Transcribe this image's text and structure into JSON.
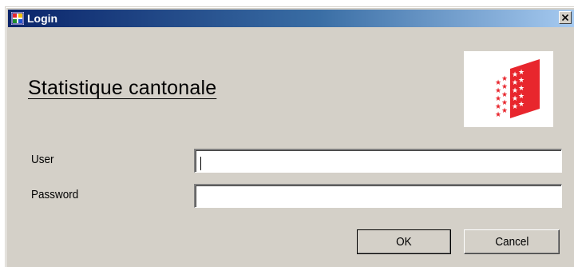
{
  "window": {
    "title": "Login",
    "close_label": "×"
  },
  "heading": "Statistique cantonale",
  "logo": {
    "icon": "canton-valais-flag-icon",
    "colors": {
      "red": "#e8262d",
      "white": "#ffffff"
    }
  },
  "form": {
    "user_label": "User",
    "user_value": "",
    "password_label": "Password",
    "password_value": ""
  },
  "buttons": {
    "ok_label": "OK",
    "cancel_label": "Cancel"
  },
  "colors": {
    "titlebar_start": "#0a246a",
    "titlebar_end": "#a6caf0",
    "dialog_background": "#d4d0c8"
  }
}
